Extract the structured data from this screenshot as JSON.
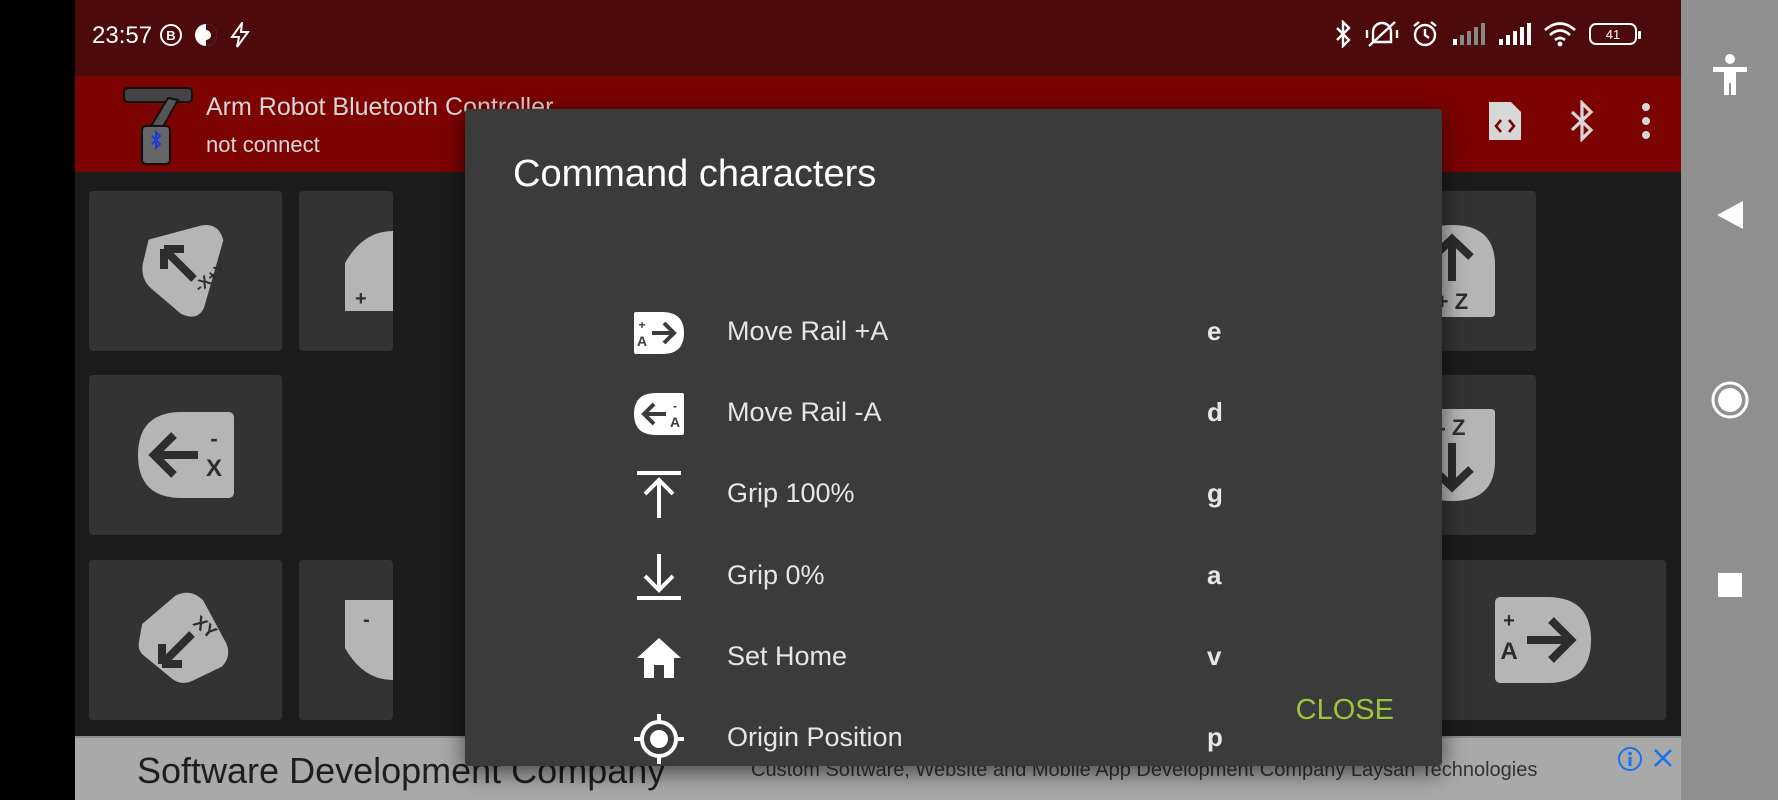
{
  "status_bar": {
    "time": "23:57",
    "battery_level": "41"
  },
  "app_bar": {
    "title": "Arm Robot Bluetooth Controller",
    "subtitle": "not connect"
  },
  "tiles": {
    "up_left_label": "-X+Y",
    "left_label_sign": "-",
    "left_label_axis": "X",
    "down_left_label": "XY",
    "up_z_label": "+ Z",
    "down_z_label": "- Z",
    "rail_plus_sign": "+",
    "rail_plus_axis": "A",
    "partial_plus": "+",
    "partial_minus": "-"
  },
  "dialog": {
    "title": "Command characters",
    "commands": [
      {
        "label": "Move Rail +A",
        "char": "e",
        "icon": "move-rail-plus-icon"
      },
      {
        "label": "Move Rail -A",
        "char": "d",
        "icon": "move-rail-minus-icon"
      },
      {
        "label": "Grip 100%",
        "char": "g",
        "icon": "grip-open-icon"
      },
      {
        "label": "Grip 0%",
        "char": "a",
        "icon": "grip-close-icon"
      },
      {
        "label": "Set Home",
        "char": "v",
        "icon": "home-icon"
      },
      {
        "label": "Origin Position",
        "char": "p",
        "icon": "origin-target-icon"
      }
    ],
    "close_label": "CLOSE"
  },
  "ad": {
    "title": "Software Development Company",
    "description": "Custom Software, Website and Mobile App Development Company Laysan Technologies"
  },
  "colors": {
    "status_bar": "#4d0a0a",
    "app_bar": "#7d0202",
    "dialog_bg": "#3b3b3b",
    "close_accent": "#9ec43a",
    "tile_bg": "#333333",
    "tile_icon": "#b5b5b5"
  }
}
